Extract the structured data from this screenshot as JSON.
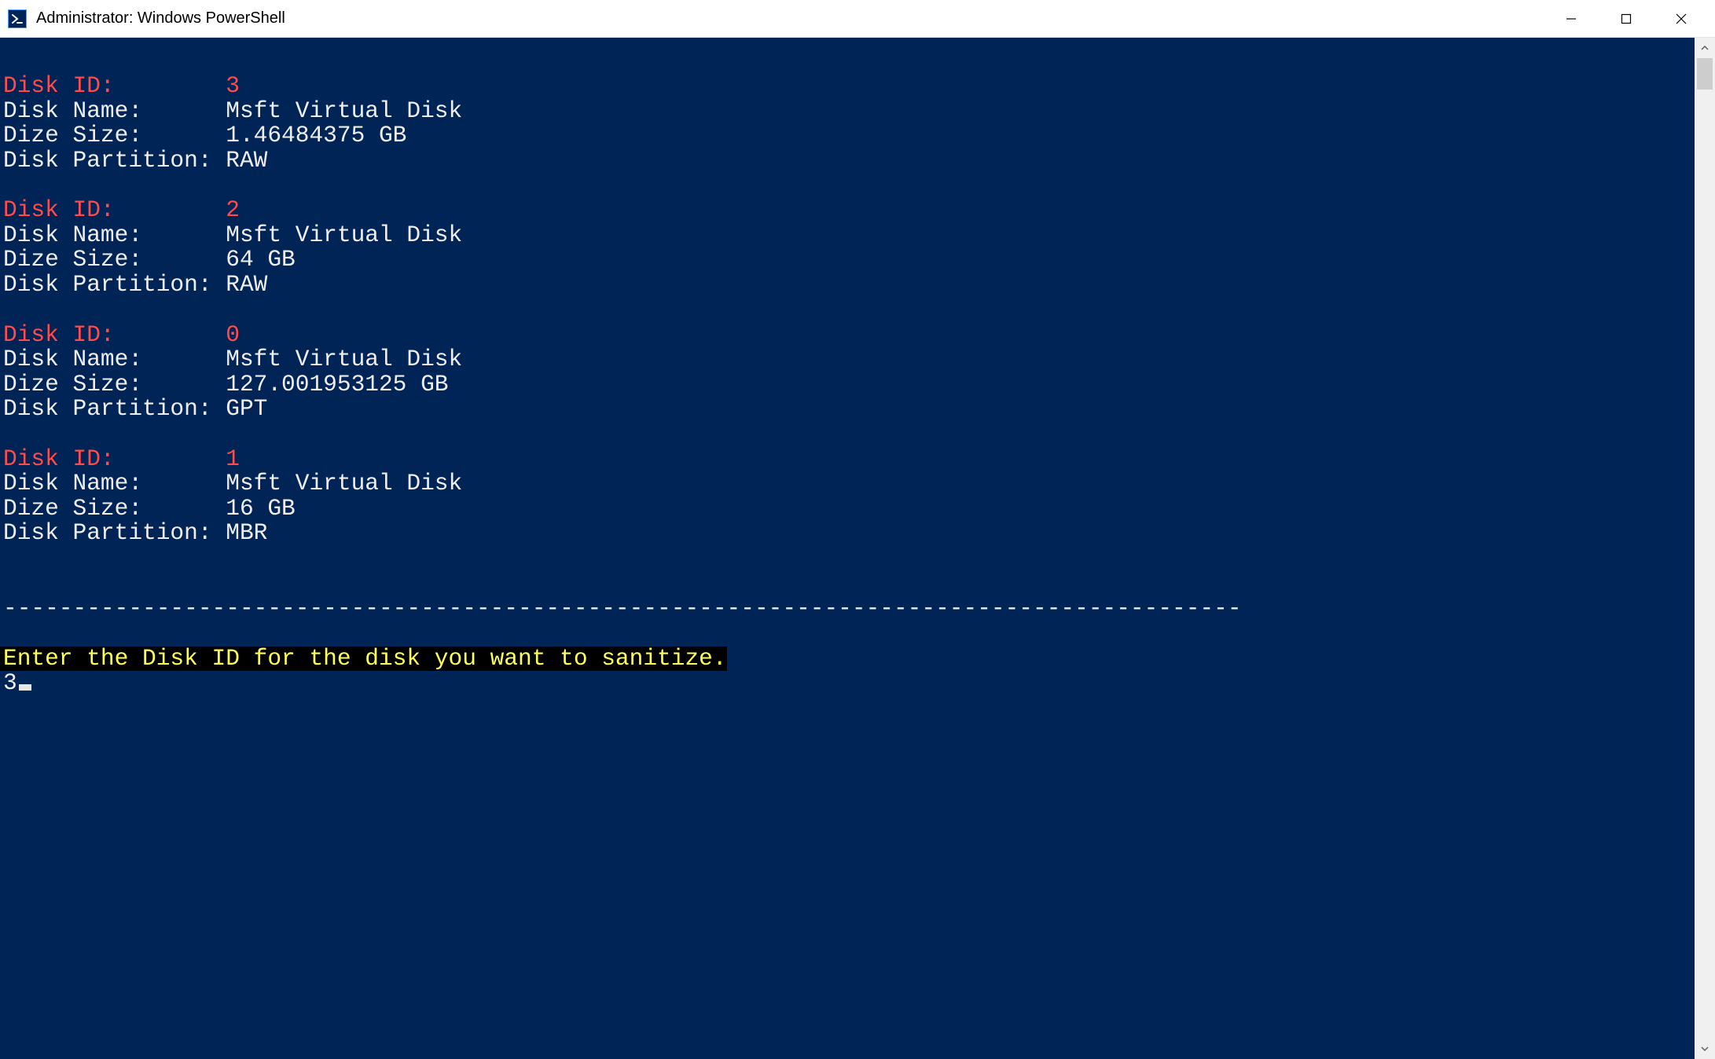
{
  "window": {
    "title": "Administrator: Windows PowerShell"
  },
  "labels": {
    "disk_id": "Disk ID:",
    "disk_name": "Disk Name:",
    "disk_size": "Dize Size:",
    "disk_partition": "Disk Partition:"
  },
  "disks": [
    {
      "id": "3",
      "name": "Msft Virtual Disk",
      "size": "1.46484375 GB",
      "partition": "RAW"
    },
    {
      "id": "2",
      "name": "Msft Virtual Disk",
      "size": "64 GB",
      "partition": "RAW"
    },
    {
      "id": "0",
      "name": "Msft Virtual Disk",
      "size": "127.001953125 GB",
      "partition": "GPT"
    },
    {
      "id": "1",
      "name": "Msft Virtual Disk",
      "size": "16 GB",
      "partition": "MBR"
    }
  ],
  "separator": "-----------------------------------------------------------------------------------------",
  "prompt": "Enter the Disk ID for the disk you want to sanitize.",
  "input_value": "3"
}
